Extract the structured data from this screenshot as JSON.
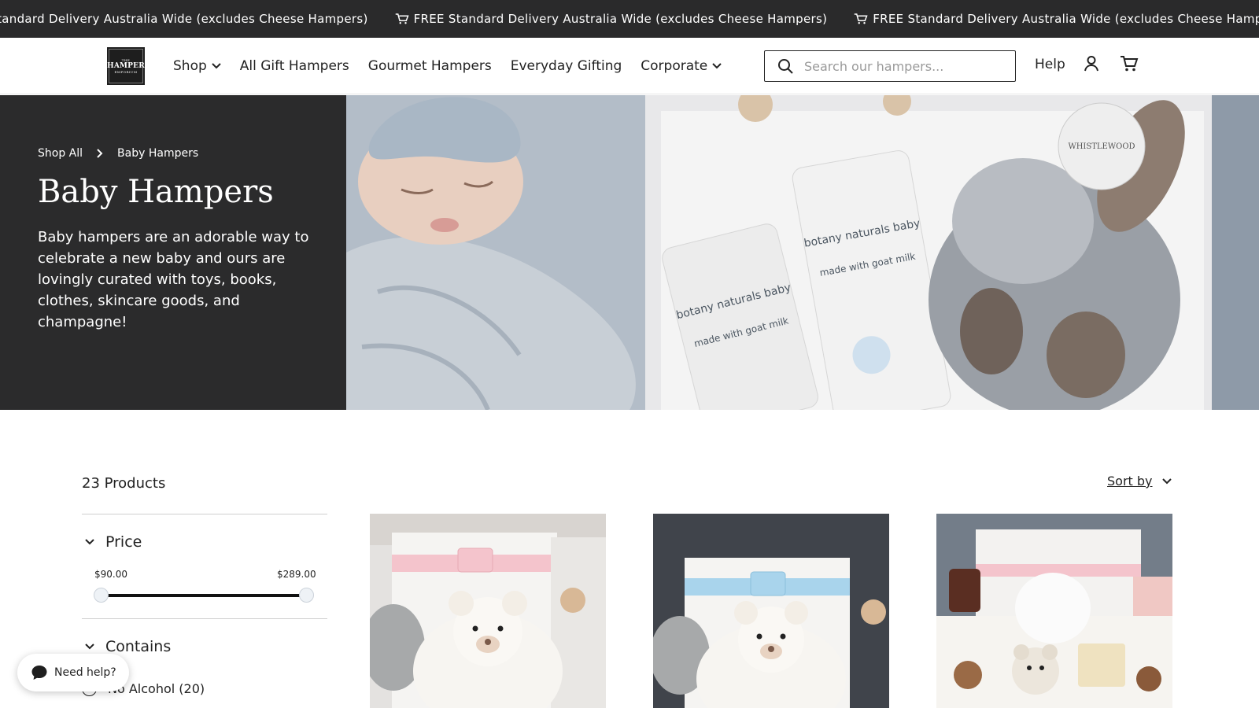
{
  "announcement": {
    "text": "FREE Standard Delivery Australia Wide (excludes Cheese Hampers)",
    "icon": "cart-icon"
  },
  "header": {
    "logo": {
      "line1": "THE",
      "line2": "HAMPER",
      "line3": "EMPORIUM"
    },
    "nav": [
      {
        "label": "Shop",
        "has_dropdown": true
      },
      {
        "label": "All Gift Hampers",
        "has_dropdown": false
      },
      {
        "label": "Gourmet Hampers",
        "has_dropdown": false
      },
      {
        "label": "Everyday Gifting",
        "has_dropdown": false
      },
      {
        "label": "Corporate",
        "has_dropdown": true
      }
    ],
    "search_placeholder": "Search our hampers...",
    "help_label": "Help",
    "icons": [
      "search-icon",
      "account-icon",
      "cart-icon"
    ]
  },
  "hero": {
    "breadcrumb": [
      "Shop All",
      "Baby Hampers"
    ],
    "title": "Baby Hampers",
    "description": "Baby hampers are an adorable way to celebrate a new baby and ours are lovingly curated with toys, books, clothes, skincare goods, and champagne!",
    "image_text": {
      "tube_brand": "botany naturals baby",
      "tube_sub": "made with goat milk",
      "tag": "WHISTLEWOOD"
    }
  },
  "listing": {
    "product_count": "23 Products",
    "sort_label": "Sort by"
  },
  "filters": {
    "price": {
      "label": "Price",
      "min_label": "$90.00",
      "max_label": "$289.00",
      "selected_range": [
        90,
        289
      ]
    },
    "contains": {
      "label": "Contains",
      "options": [
        {
          "label": "No Alcohol (20)",
          "checked": false
        }
      ]
    }
  },
  "products": [
    {
      "ribbon_color": "#f4c4cc"
    },
    {
      "ribbon_color": "#a9d4ec"
    },
    {
      "ribbon_color": "#f4c4cc"
    }
  ],
  "chat": {
    "label": "Need help?"
  },
  "colors": {
    "dark": "#2b2b2c",
    "announcement_bg": "#2a2a2b",
    "accent_black": "#111111"
  }
}
